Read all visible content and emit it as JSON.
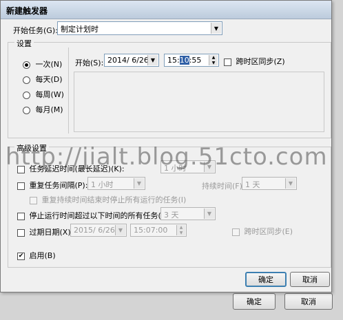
{
  "window": {
    "title": "新建触发器"
  },
  "start_task": {
    "label": "开始任务(G):",
    "value": "制定计划时"
  },
  "settings": {
    "group_title": "设置",
    "radios": [
      {
        "label": "一次(N)",
        "selected": true
      },
      {
        "label": "每天(D)",
        "selected": false
      },
      {
        "label": "每周(W)",
        "selected": false
      },
      {
        "label": "每月(M)",
        "selected": false
      }
    ],
    "start_label": "开始(S):",
    "start_date": "2014/  6/26",
    "start_time_prefix": "15:",
    "start_time_selected": "10",
    "start_time_suffix": ":55",
    "sync_label": "跨时区同步(Z)"
  },
  "advanced": {
    "group_title": "高级设置",
    "delay_label": "任务延迟时间(最长延迟)(K):",
    "delay_value": "1 小时",
    "repeat_label": "重复任务间隔(P):",
    "repeat_value": "1 小时",
    "duration_label": "持续时间(F):",
    "duration_value": "1 天",
    "stop_at_end_label": "重复持续时间结束时停止所有运行的任务(I)",
    "stop_long_label": "停止运行时间超过以下时间的所有任务(L):",
    "stop_long_value": "3 天",
    "expire_label": "过期日期(X):",
    "expire_date": "2015/  6/26",
    "expire_time": "15:07:00",
    "expire_sync_label": "跨时区同步(E)",
    "enabled_label": "启用(B)",
    "enabled_checked": "✔"
  },
  "buttons": {
    "ok": "确定",
    "cancel": "取消",
    "ok_back": "确定",
    "cancel_back": "取消"
  },
  "watermark": "http://jialt.blog.51cto.com"
}
